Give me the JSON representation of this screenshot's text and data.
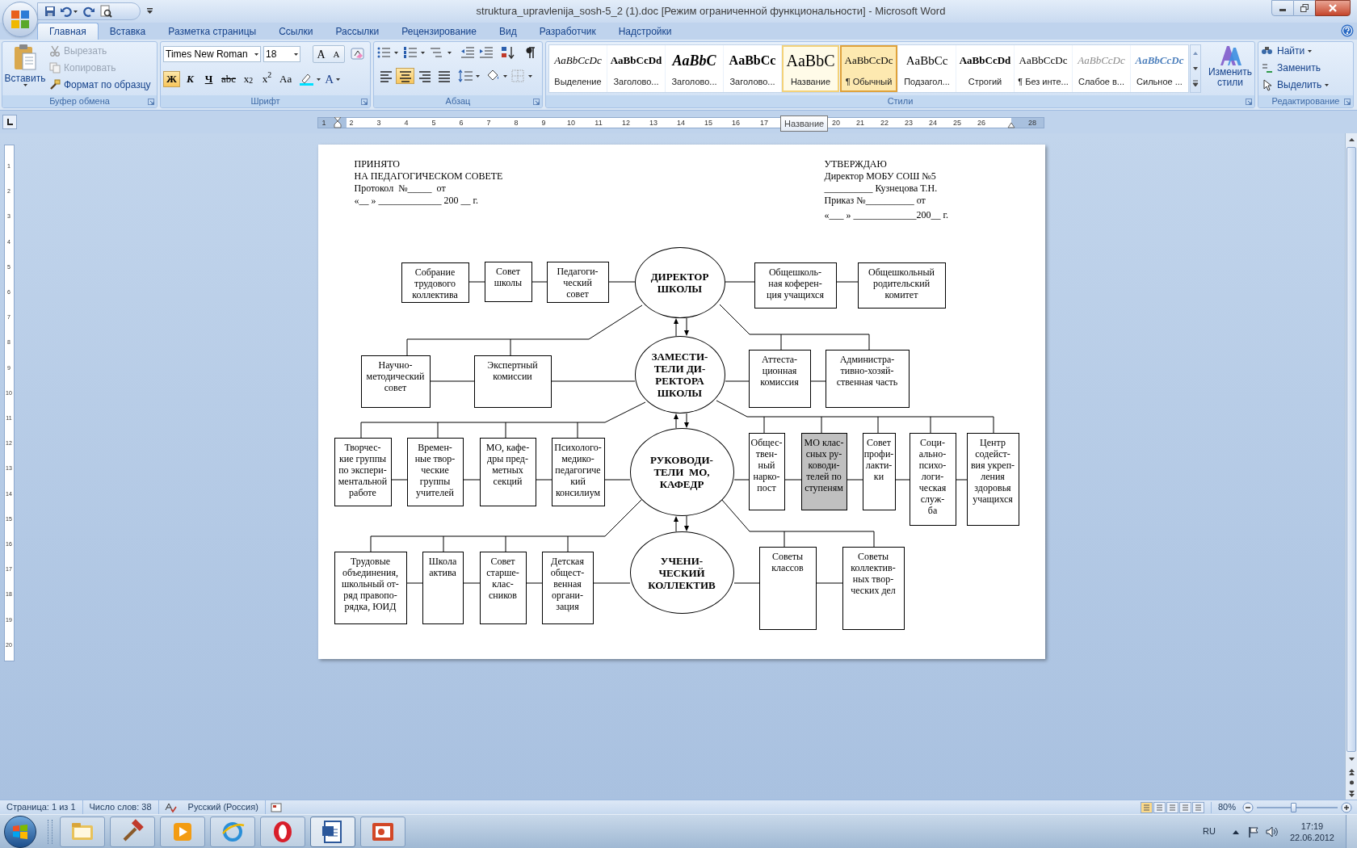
{
  "window": {
    "title": "struktura_upravlenija_sosh-5_2 (1).doc [Режим ограниченной функциональности] - Microsoft Word"
  },
  "tabs": [
    {
      "label": "Главная",
      "selected": true
    },
    {
      "label": "Вставка",
      "selected": false
    },
    {
      "label": "Разметка страницы",
      "selected": false
    },
    {
      "label": "Ссылки",
      "selected": false
    },
    {
      "label": "Рассылки",
      "selected": false
    },
    {
      "label": "Рецензирование",
      "selected": false
    },
    {
      "label": "Вид",
      "selected": false
    },
    {
      "label": "Разработчик",
      "selected": false
    },
    {
      "label": "Надстройки",
      "selected": false
    }
  ],
  "ribbon": {
    "clipboard": {
      "title": "Буфер обмена",
      "paste": "Вставить",
      "items": [
        {
          "label": "Вырезать",
          "disabled": true
        },
        {
          "label": "Копировать",
          "disabled": true
        },
        {
          "label": "Формат по образцу",
          "disabled": false
        }
      ]
    },
    "font": {
      "title": "Шрифт",
      "font_name": "Times New Roman",
      "font_size": "18",
      "grow": "A",
      "shrink": "A",
      "format_buttons": [
        {
          "label": "Ж",
          "selected": true
        },
        {
          "label": "К",
          "selected": false
        },
        {
          "label": "Ч",
          "selected": false
        },
        {
          "label": "abc",
          "selected": false
        },
        {
          "label": "x$_{2}$",
          "selected": false
        },
        {
          "label": "x$^{2}$",
          "selected": false
        },
        {
          "label": "Aa",
          "selected": false
        }
      ],
      "font_color": "A"
    },
    "paragraph": {
      "title": "Абзац",
      "alignments": [
        {
          "selected": false
        },
        {
          "selected": true
        },
        {
          "selected": false
        },
        {
          "selected": false
        }
      ]
    },
    "styles": {
      "title": "Стили",
      "change_styles": "Изменить стили",
      "items": [
        {
          "preview": "AaBbCcDc",
          "label": "Выделение",
          "kind": "emphasis",
          "selected": false,
          "hovered": false
        },
        {
          "preview": "AaBbCcDd",
          "label": "Заголово...",
          "kind": "heading1",
          "selected": false,
          "hovered": false
        },
        {
          "preview": "AaBbC",
          "label": "Заголово...",
          "kind": "heading2",
          "selected": false,
          "hovered": false
        },
        {
          "preview": "AaBbCc",
          "label": "Заголово...",
          "kind": "heading3",
          "selected": false,
          "hovered": false
        },
        {
          "preview": "AaBbC",
          "label": "Название",
          "kind": "title",
          "selected": false,
          "hovered": true
        },
        {
          "preview": "AaBbCcDc",
          "label": "¶ Обычный",
          "kind": "normal",
          "selected": true,
          "hovered": false
        },
        {
          "preview": "AaBbCc",
          "label": "Подзагол...",
          "kind": "subtitle",
          "selected": false,
          "hovered": false
        },
        {
          "preview": "AaBbCcDd",
          "label": "Строгий",
          "kind": "strong",
          "selected": false,
          "hovered": false
        },
        {
          "preview": "AaBbCcDc",
          "label": "¶ Без инте...",
          "kind": "normal",
          "selected": false,
          "hovered": false
        },
        {
          "preview": "AaBbCcDc",
          "label": "Слабое в...",
          "kind": "subtle",
          "selected": false,
          "hovered": false
        },
        {
          "preview": "AaBbCcDc",
          "label": "Сильное ...",
          "kind": "intense",
          "selected": false,
          "hovered": false
        }
      ]
    },
    "editing": {
      "title": "Редактирование",
      "items": [
        "Найти",
        "Заменить",
        "Выделить"
      ]
    }
  },
  "ruler": {
    "numbers": [
      "1",
      "2",
      "3",
      "4",
      "5",
      "6",
      "7",
      "8",
      "9",
      "10",
      "11",
      "12",
      "13",
      "14",
      "15",
      "16",
      "17",
      "20",
      "21",
      "22",
      "23",
      "24",
      "25",
      "26",
      "28"
    ],
    "tooltip": "Название"
  },
  "vertical_ruler": {
    "numbers": [
      "1",
      "2",
      "3",
      "4",
      "5",
      "6",
      "7",
      "8",
      "9",
      "10",
      "11",
      "12",
      "13",
      "14",
      "15",
      "16",
      "17",
      "18",
      "19",
      "20"
    ]
  },
  "document": {
    "header_left": [
      "ПРИНЯТО",
      "НА ПЕДАГОГИЧЕСКОМ СОВЕТЕ",
      "Протокол  №_____  от",
      "«__ » _____________ 200 __ г."
    ],
    "header_right": [
      "УТВЕРЖДАЮ",
      "Директор МОБУ СОШ №5",
      "__________ Кузнецова Т.Н.",
      "Приказ №__________ от",
      "«___ » _____________200__ г."
    ],
    "ellipses": [
      {
        "lines": [
          "ДИРЕКТОР",
          "ШКОЛЫ"
        ]
      },
      {
        "lines": [
          "ЗАМЕСТИ-",
          "ТЕЛИ ДИ-",
          "РЕКТОРА",
          "ШКОЛЫ"
        ]
      },
      {
        "lines": [
          "РУКОВОДИ-",
          "ТЕЛИ  МО,",
          "КАФЕДР"
        ]
      },
      {
        "lines": [
          "УЧЕНИ-",
          "ЧЕСКИЙ",
          "КОЛЛЕКТИВ"
        ]
      }
    ],
    "boxes": [
      {
        "lines": [
          "Собрание",
          "трудового",
          "коллектива"
        ],
        "shaded": false
      },
      {
        "lines": [
          "Совет",
          "школы"
        ],
        "shaded": false
      },
      {
        "lines": [
          "Педагоги-",
          "ческий",
          "совет"
        ],
        "shaded": false
      },
      {
        "lines": [
          "Общешколь-",
          "ная коферен-",
          "ция учащихся"
        ],
        "shaded": false
      },
      {
        "lines": [
          "Общешкольный",
          "родительский",
          "комитет"
        ],
        "shaded": false
      },
      {
        "lines": [
          "Научно-",
          "методический",
          "совет"
        ],
        "shaded": false
      },
      {
        "lines": [
          "Экспертный",
          "комиссии"
        ],
        "shaded": false
      },
      {
        "lines": [
          "Аттеста-",
          "ционная",
          "комиссия"
        ],
        "shaded": false
      },
      {
        "lines": [
          "Администра-",
          "тивно-хозяй-",
          "ственная часть"
        ],
        "shaded": false
      },
      {
        "lines": [
          "Творчес-",
          "кие группы",
          "по экспери-",
          "ментальной",
          "работе"
        ],
        "shaded": false
      },
      {
        "lines": [
          "Времен-",
          "ные твор-",
          "ческие",
          "группы",
          "учителей"
        ],
        "shaded": false
      },
      {
        "lines": [
          "МО, кафе-",
          "дры пред-",
          "метных",
          "секций"
        ],
        "shaded": false
      },
      {
        "lines": [
          "Психолого-",
          "медико-",
          "педагогиче",
          "кий",
          "консилиум"
        ],
        "shaded": false
      },
      {
        "lines": [
          "Общес-",
          "твен-",
          "ный",
          "нарко-",
          "пост"
        ],
        "shaded": false
      },
      {
        "lines": [
          "МО клас-",
          "сных ру-",
          "ководи-",
          "телей по",
          "ступеням"
        ],
        "shaded": true
      },
      {
        "lines": [
          "Совет",
          "профи-",
          "лакти-",
          "ки"
        ],
        "shaded": false
      },
      {
        "lines": [
          "Соци-",
          "ально-",
          "психо-",
          "логи-",
          "ческая",
          "служ-",
          "ба"
        ],
        "shaded": false
      },
      {
        "lines": [
          "Центр",
          "содейст-",
          "вия укреп-",
          "ления",
          "здоровья",
          "учащихся"
        ],
        "shaded": false
      },
      {
        "lines": [
          "Трудовые",
          "объединения,",
          "школьный от-",
          "ряд правопо-",
          "рядка, ЮИД"
        ],
        "shaded": false
      },
      {
        "lines": [
          "Школа",
          "актива"
        ],
        "shaded": false
      },
      {
        "lines": [
          "Совет",
          "старше-",
          "клас-",
          "сников"
        ],
        "shaded": false
      },
      {
        "lines": [
          "Детская",
          "общест-",
          "венная",
          "органи-",
          "зация"
        ],
        "shaded": false
      },
      {
        "lines": [
          "Советы",
          "классов"
        ],
        "shaded": false
      },
      {
        "lines": [
          "Советы",
          "коллектив-",
          "ных твор-",
          "ческих дел"
        ],
        "shaded": false
      }
    ]
  },
  "status_bar": {
    "page": "Страница: 1 из 1",
    "words": "Число слов: 38",
    "language": "Русский (Россия)",
    "zoom": "80%",
    "zoom_slider": {
      "level": 0.45
    }
  },
  "taskbar": {
    "apps": [
      {
        "kind": "folder"
      },
      {
        "kind": "tools"
      },
      {
        "kind": "media"
      },
      {
        "kind": "browser"
      },
      {
        "kind": "opera"
      },
      {
        "kind": "word"
      },
      {
        "kind": "slides"
      }
    ],
    "language": "RU",
    "time": "17:19",
    "date": "22.06.2012"
  }
}
